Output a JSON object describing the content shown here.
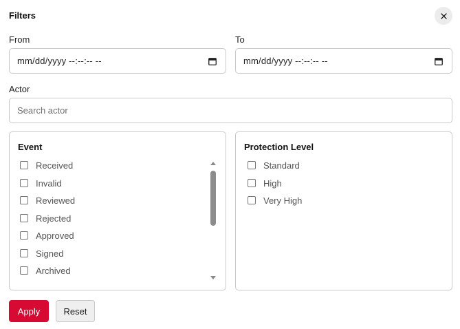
{
  "dialog": {
    "title": "Filters",
    "close_icon": "close-icon"
  },
  "from": {
    "label": "From",
    "value": "mm/dd/yyyy --:--:-- --",
    "icon": "calendar-icon"
  },
  "to": {
    "label": "To",
    "value": "mm/dd/yyyy --:--:-- --",
    "icon": "calendar-icon"
  },
  "actor": {
    "label": "Actor",
    "placeholder": "Search actor"
  },
  "event": {
    "title": "Event",
    "options": [
      {
        "label": "Received",
        "checked": false
      },
      {
        "label": "Invalid",
        "checked": false
      },
      {
        "label": "Reviewed",
        "checked": false
      },
      {
        "label": "Rejected",
        "checked": false
      },
      {
        "label": "Approved",
        "checked": false
      },
      {
        "label": "Signed",
        "checked": false
      },
      {
        "label": "Archived",
        "checked": false
      }
    ]
  },
  "protection_level": {
    "title": "Protection Level",
    "options": [
      {
        "label": "Standard",
        "checked": false
      },
      {
        "label": "High",
        "checked": false
      },
      {
        "label": "Very High",
        "checked": false
      }
    ]
  },
  "actions": {
    "apply_label": "Apply",
    "reset_label": "Reset"
  },
  "colors": {
    "apply_bg": "#d60a32",
    "reset_bg": "#efefef"
  }
}
